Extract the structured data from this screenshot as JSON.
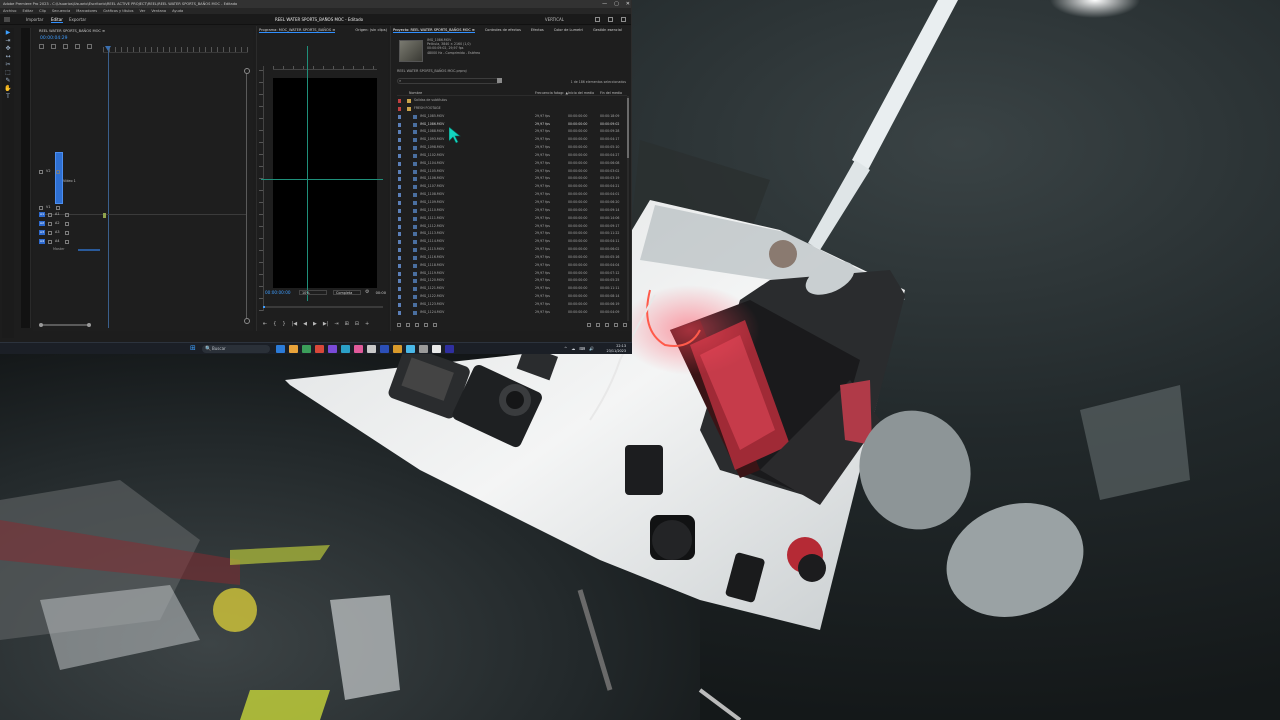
{
  "window": {
    "title": "Adobe Premiere Pro 2023 - C:\\Usuarios\\Usuario\\Escritorio\\REEL ACTIVE PROJECT\\REEL\\REEL WATER SPORTS_BAÑOS MOC - Editado",
    "controls": [
      "—",
      "▢",
      "✕"
    ]
  },
  "menu": [
    "Archivo",
    "Editar",
    "Clip",
    "Secuencia",
    "Marcadores",
    "Gráficos y títulos",
    "Ver",
    "Ventana",
    "Ayuda"
  ],
  "workspaces": {
    "tabs": [
      "Importar",
      "Editar",
      "Exportar"
    ],
    "active": "Editar",
    "center_title": "REEL WATER SPORTS_BAÑOS MOC - Editado",
    "right_label": "VERTICAL"
  },
  "tools": [
    "▶",
    "⇥",
    "✥",
    "↔",
    "✂",
    "⬚",
    "✎",
    "✋",
    "T"
  ],
  "timeline": {
    "tab": "REEL WATER SPORTS_BAÑOS MOC ≡",
    "timecode": "00:00:04:29",
    "tracks": [
      {
        "name": "V2",
        "target": "V1"
      },
      {
        "name": "V1",
        "target": "V1"
      },
      {
        "name": "A1",
        "target": "A1"
      },
      {
        "name": "A2",
        "target": "A2"
      },
      {
        "name": "A3",
        "target": "A3"
      },
      {
        "name": "A4",
        "target": "A4"
      }
    ],
    "video_label": "Vídeo 1",
    "master": "Master"
  },
  "program": {
    "tabs": [
      "Programa: MOC_WATER SPORTS_BAÑOS ≡",
      "Origen: (sin clips)"
    ],
    "timecode": "00:00:00:00",
    "zoom": "10%",
    "quality": "Completa",
    "duration": "00:00",
    "transport": [
      "⇤",
      "{",
      "}",
      "|◀",
      "◀",
      "▶",
      "▶|",
      "⇥",
      "⊞",
      "⊟",
      "+"
    ],
    "scrub_progress": 0.02
  },
  "project": {
    "tabs": [
      "Proyecto: REEL WATER SPORTS_BAÑOS MOC ≡",
      "Controles de efectos",
      "Efectos",
      "Color de Lumetri",
      "Gestión esencial"
    ],
    "active_tab_index": 0,
    "thumb_meta": [
      "IMG_1086.MOV",
      "Película, 3840 × 2160 (1,0)",
      "00:00:09:02, 29,97 fps",
      "48000 Hz - Comprimido - Estéreo"
    ],
    "path": "REEL WATER SPORTS_BAÑOS MOC.prproj",
    "search_placeholder": "",
    "selection_count": "1 de 186 elementos seleccionados",
    "columns": {
      "name": "Nombre",
      "fps": "Frecuencia fotogr. ▲",
      "start": "Inicio del medio",
      "end": "Fin del medio"
    },
    "rows": [
      {
        "name": "Salidas de subtítulos",
        "fps": "",
        "start": "",
        "end": "",
        "type": "bin",
        "swatch": "#c04040"
      },
      {
        "name": "FRESH FOOTAGE",
        "fps": "",
        "start": "",
        "end": "",
        "type": "bin",
        "swatch": "#c04040"
      },
      {
        "name": "IMG_1085.MOV",
        "fps": "29,97 fps",
        "start": "00:00:00:00",
        "end": "00:00:18:09",
        "type": "clip",
        "swatch": "#5b7fb8"
      },
      {
        "name": "IMG_1086.MOV",
        "fps": "29,97 fps",
        "start": "00:00:00:00",
        "end": "00:00:09:02",
        "type": "clip",
        "swatch": "#5b7fb8",
        "highlight": true
      },
      {
        "name": "IMG_1088.MOV",
        "fps": "29,97 fps",
        "start": "00:00:00:00",
        "end": "00:00:09:28",
        "type": "clip",
        "swatch": "#5b7fb8"
      },
      {
        "name": "IMG_1093.MOV",
        "fps": "29,97 fps",
        "start": "00:00:00:00",
        "end": "00:00:04:17",
        "type": "clip",
        "swatch": "#5b7fb8"
      },
      {
        "name": "IMG_1098.MOV",
        "fps": "29,97 fps",
        "start": "00:00:00:00",
        "end": "00:00:05:10",
        "type": "clip",
        "swatch": "#5b7fb8"
      },
      {
        "name": "IMG_1102.MOV",
        "fps": "29,97 fps",
        "start": "00:00:00:00",
        "end": "00:00:04:27",
        "type": "clip",
        "swatch": "#5b7fb8"
      },
      {
        "name": "IMG_1104.MOV",
        "fps": "29,97 fps",
        "start": "00:00:00:00",
        "end": "00:00:06:08",
        "type": "clip",
        "swatch": "#5b7fb8"
      },
      {
        "name": "IMG_1105.MOV",
        "fps": "29,97 fps",
        "start": "00:00:00:00",
        "end": "00:00:03:02",
        "type": "clip",
        "swatch": "#5b7fb8"
      },
      {
        "name": "IMG_1106.MOV",
        "fps": "29,97 fps",
        "start": "00:00:00:00",
        "end": "00:00:03:19",
        "type": "clip",
        "swatch": "#5b7fb8"
      },
      {
        "name": "IMG_1107.MOV",
        "fps": "29,97 fps",
        "start": "00:00:00:00",
        "end": "00:00:04:21",
        "type": "clip",
        "swatch": "#5b7fb8"
      },
      {
        "name": "IMG_1108.MOV",
        "fps": "29,97 fps",
        "start": "00:00:00:00",
        "end": "00:00:04:01",
        "type": "clip",
        "swatch": "#5b7fb8"
      },
      {
        "name": "IMG_1109.MOV",
        "fps": "29,97 fps",
        "start": "00:00:00:00",
        "end": "00:00:06:20",
        "type": "clip",
        "swatch": "#5b7fb8"
      },
      {
        "name": "IMG_1110.MOV",
        "fps": "29,97 fps",
        "start": "00:00:00:00",
        "end": "00:00:09:14",
        "type": "clip",
        "swatch": "#5b7fb8"
      },
      {
        "name": "IMG_1111.MOV",
        "fps": "29,97 fps",
        "start": "00:00:00:00",
        "end": "00:00:14:06",
        "type": "clip",
        "swatch": "#5b7fb8"
      },
      {
        "name": "IMG_1112.MOV",
        "fps": "29,97 fps",
        "start": "00:00:00:00",
        "end": "00:00:09:17",
        "type": "clip",
        "swatch": "#5b7fb8"
      },
      {
        "name": "IMG_1113.MOV",
        "fps": "29,97 fps",
        "start": "00:00:00:00",
        "end": "00:00:11:22",
        "type": "clip",
        "swatch": "#5b7fb8"
      },
      {
        "name": "IMG_1114.MOV",
        "fps": "29,97 fps",
        "start": "00:00:00:00",
        "end": "00:00:04:11",
        "type": "clip",
        "swatch": "#5b7fb8"
      },
      {
        "name": "IMG_1115.MOV",
        "fps": "29,97 fps",
        "start": "00:00:00:00",
        "end": "00:00:06:02",
        "type": "clip",
        "swatch": "#5b7fb8"
      },
      {
        "name": "IMG_1116.MOV",
        "fps": "29,97 fps",
        "start": "00:00:00:00",
        "end": "00:00:05:16",
        "type": "clip",
        "swatch": "#5b7fb8"
      },
      {
        "name": "IMG_1118.MOV",
        "fps": "29,97 fps",
        "start": "00:00:00:00",
        "end": "00:00:04:04",
        "type": "clip",
        "swatch": "#5b7fb8"
      },
      {
        "name": "IMG_1119.MOV",
        "fps": "29,97 fps",
        "start": "00:00:00:00",
        "end": "00:00:07:12",
        "type": "clip",
        "swatch": "#5b7fb8"
      },
      {
        "name": "IMG_1120.MOV",
        "fps": "29,97 fps",
        "start": "00:00:00:00",
        "end": "00:00:05:25",
        "type": "clip",
        "swatch": "#5b7fb8"
      },
      {
        "name": "IMG_1121.MOV",
        "fps": "29,97 fps",
        "start": "00:00:00:00",
        "end": "00:00:11:11",
        "type": "clip",
        "swatch": "#5b7fb8"
      },
      {
        "name": "IMG_1122.MOV",
        "fps": "29,97 fps",
        "start": "00:00:00:00",
        "end": "00:00:08:14",
        "type": "clip",
        "swatch": "#5b7fb8"
      },
      {
        "name": "IMG_1123.MOV",
        "fps": "29,97 fps",
        "start": "00:00:00:00",
        "end": "00:00:06:19",
        "type": "clip",
        "swatch": "#5b7fb8"
      },
      {
        "name": "IMG_1124.MOV",
        "fps": "29,97 fps",
        "start": "00:00:00:00",
        "end": "00:00:04:09",
        "type": "clip",
        "swatch": "#5b7fb8"
      },
      {
        "name": "IMG_1125.MOV",
        "fps": "29,97 fps",
        "start": "00:00:00:00",
        "end": "00:00:05:12",
        "type": "clip",
        "swatch": "#5b7fb8"
      }
    ]
  },
  "taskbar": {
    "search_label": "Buscar",
    "search_icon": "🔍",
    "start_icon": "⊞",
    "apps": [
      "#2b7bd8",
      "#e8a33a",
      "#3b9e5a",
      "#d8483a",
      "#7a4ad8",
      "#2ba0c8",
      "#e05a9a",
      "#c8c8c8",
      "#2b4fb8",
      "#d89a2b",
      "#4ab8e8",
      "#9a9a9a",
      "#e8e8e8",
      "#2f2fa0"
    ],
    "tray": [
      "^",
      "☁",
      "⌨",
      "🔊"
    ],
    "time": "22:13",
    "date": "23/11/2023"
  }
}
